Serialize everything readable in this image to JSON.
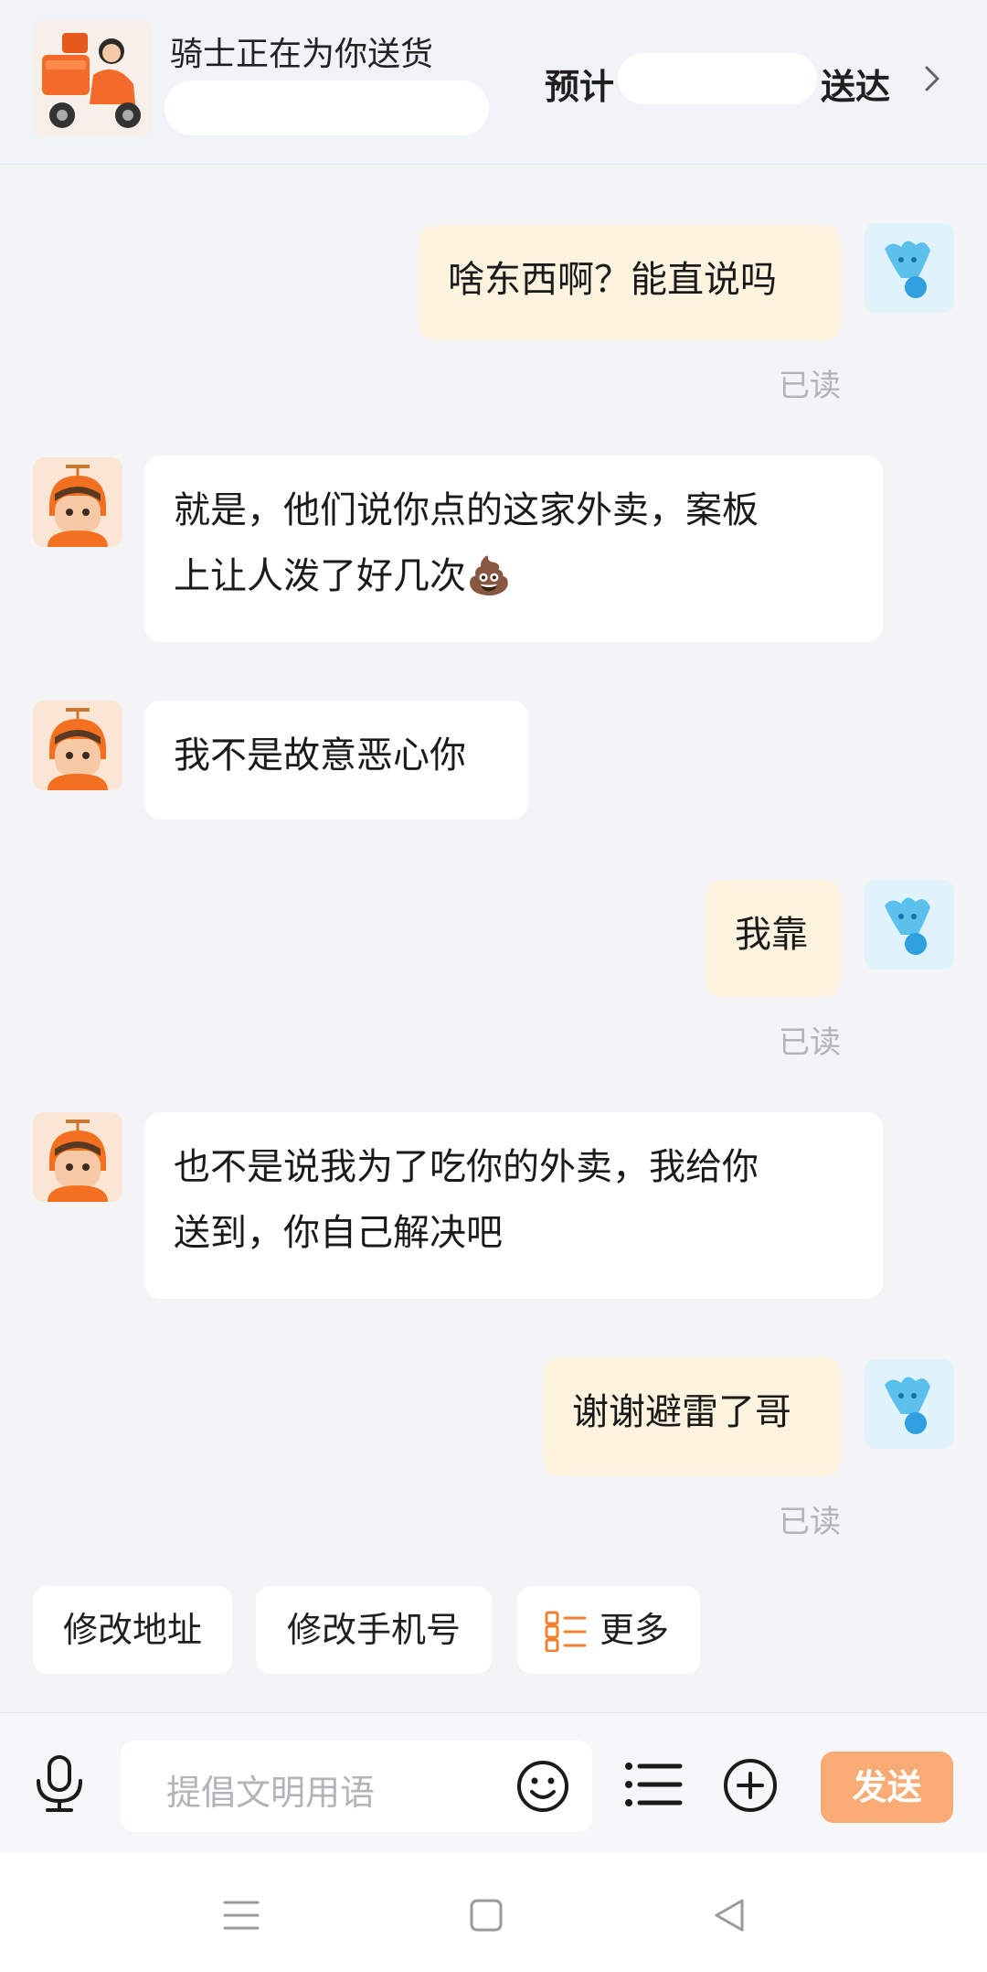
{
  "header": {
    "title": "骑士正在为你送货",
    "eta_prefix": "预计",
    "eta_suffix": "送达"
  },
  "messages": [
    {
      "sender": "user",
      "text": "啥东西啊？能直说吗",
      "status": "已读"
    },
    {
      "sender": "rider",
      "text": "就是，他们说你点的这家外卖，案板\n上让人泼了好几次💩"
    },
    {
      "sender": "rider",
      "text": "我不是故意恶心你"
    },
    {
      "sender": "user",
      "text": "我靠",
      "status": "已读"
    },
    {
      "sender": "rider",
      "text": "也不是说我为了吃你的外卖，我给你\n送到，你自己解决吧"
    },
    {
      "sender": "user",
      "text": "谢谢避雷了哥",
      "status": "已读"
    }
  ],
  "quick_replies": {
    "edit_address": "修改地址",
    "edit_phone": "修改手机号",
    "more": "更多"
  },
  "input": {
    "placeholder": "提倡文明用语",
    "send_label": "发送"
  },
  "colors": {
    "accent_orange": "#f08030",
    "send_button": "#f8ab74",
    "user_bubble": "#fdf3df",
    "rider_bubble": "#ffffff"
  }
}
